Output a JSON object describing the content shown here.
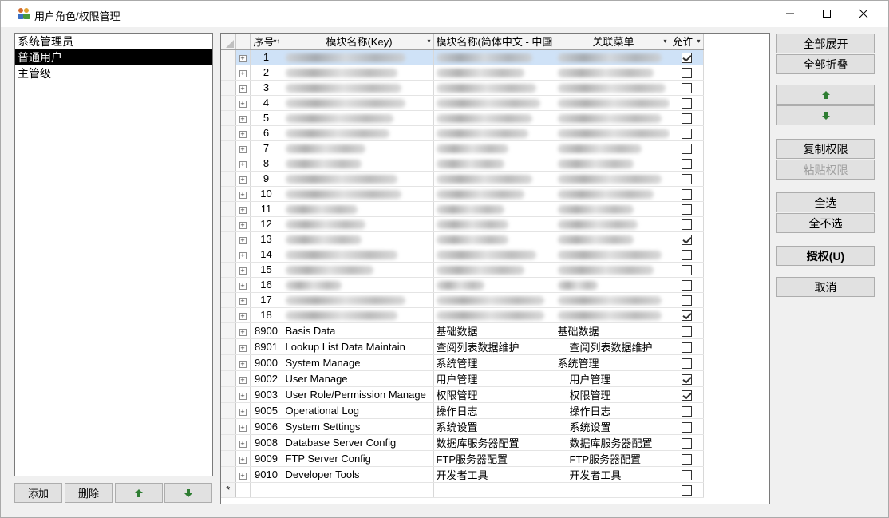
{
  "window": {
    "title": "用户角色/权限管理"
  },
  "roles": {
    "items": [
      {
        "label": "系统管理员",
        "selected": false
      },
      {
        "label": "普通用户",
        "selected": true
      },
      {
        "label": "主管级",
        "selected": false
      }
    ],
    "add_label": "添加",
    "delete_label": "删除"
  },
  "grid": {
    "columns": {
      "seq": "序号",
      "key": "模块名称(Key)",
      "cn": "模块名称(简体中文 - 中国",
      "menu": "关联菜单",
      "allow": "允许"
    },
    "rows": [
      {
        "seq": "1",
        "key": "",
        "cn": "",
        "menu": "",
        "checked": true,
        "blurred": true
      },
      {
        "seq": "2",
        "key": "",
        "cn": "",
        "menu": "",
        "checked": false,
        "blurred": true
      },
      {
        "seq": "3",
        "key": "",
        "cn": "",
        "menu": "",
        "checked": false,
        "blurred": true
      },
      {
        "seq": "4",
        "key": "",
        "cn": "",
        "menu": "",
        "checked": false,
        "blurred": true
      },
      {
        "seq": "5",
        "key": "",
        "cn": "",
        "menu": "",
        "checked": false,
        "blurred": true
      },
      {
        "seq": "6",
        "key": "",
        "cn": "",
        "menu": "",
        "checked": false,
        "blurred": true
      },
      {
        "seq": "7",
        "key": "",
        "cn": "",
        "menu": "",
        "checked": false,
        "blurred": true
      },
      {
        "seq": "8",
        "key": "",
        "cn": "",
        "menu": "",
        "checked": false,
        "blurred": true
      },
      {
        "seq": "9",
        "key": "",
        "cn": "",
        "menu": "",
        "checked": false,
        "blurred": true
      },
      {
        "seq": "10",
        "key": "",
        "cn": "",
        "menu": "",
        "checked": false,
        "blurred": true
      },
      {
        "seq": "11",
        "key": "",
        "cn": "",
        "menu": "",
        "checked": false,
        "blurred": true
      },
      {
        "seq": "12",
        "key": "",
        "cn": "",
        "menu": "",
        "checked": false,
        "blurred": true
      },
      {
        "seq": "13",
        "key": "",
        "cn": "",
        "menu": "",
        "checked": true,
        "blurred": true
      },
      {
        "seq": "14",
        "key": "",
        "cn": "",
        "menu": "",
        "checked": false,
        "blurred": true
      },
      {
        "seq": "15",
        "key": "",
        "cn": "",
        "menu": "",
        "checked": false,
        "blurred": true
      },
      {
        "seq": "16",
        "key": "",
        "cn": "",
        "menu": "",
        "checked": false,
        "blurred": true
      },
      {
        "seq": "17",
        "key": "",
        "cn": "",
        "menu": "",
        "checked": false,
        "blurred": true
      },
      {
        "seq": "18",
        "key": "",
        "cn": "",
        "menu": "",
        "checked": true,
        "blurred": true
      },
      {
        "seq": "8900",
        "key": "Basis Data",
        "cn": "基础数据",
        "menu": "基础数据",
        "checked": false,
        "blurred": false
      },
      {
        "seq": "8901",
        "key": "Lookup List Data Maintain",
        "cn": "查阅列表数据维护",
        "menu": "查阅列表数据维护",
        "checked": false,
        "blurred": false
      },
      {
        "seq": "9000",
        "key": "System Manage",
        "cn": "系统管理",
        "menu": "系统管理",
        "checked": false,
        "blurred": false
      },
      {
        "seq": "9002",
        "key": "User Manage",
        "cn": "用户管理",
        "menu": "用户管理",
        "checked": true,
        "blurred": false
      },
      {
        "seq": "9003",
        "key": "User Role/Permission Manage",
        "cn": "权限管理",
        "menu": "权限管理",
        "checked": true,
        "blurred": false
      },
      {
        "seq": "9005",
        "key": "Operational Log",
        "cn": "操作日志",
        "menu": "操作日志",
        "checked": false,
        "blurred": false
      },
      {
        "seq": "9006",
        "key": "System Settings",
        "cn": "系统设置",
        "menu": "系统设置",
        "checked": false,
        "blurred": false
      },
      {
        "seq": "9008",
        "key": "Database Server Config",
        "cn": "数据库服务器配置",
        "menu": "数据库服务器配置",
        "checked": false,
        "blurred": false
      },
      {
        "seq": "9009",
        "key": "FTP Server Config",
        "cn": "FTP服务器配置",
        "menu": "FTP服务器配置",
        "checked": false,
        "blurred": false
      },
      {
        "seq": "9010",
        "key": "Developer Tools",
        "cn": "开发者工具",
        "menu": "开发者工具",
        "checked": false,
        "blurred": false
      }
    ],
    "new_row_marker": "*"
  },
  "actions": {
    "expand_all": "全部展开",
    "collapse_all": "全部折叠",
    "copy_perm": "复制权限",
    "paste_perm": "粘贴权限",
    "select_all": "全选",
    "select_none": "全不选",
    "authorize": "授权(U)",
    "cancel": "取消"
  }
}
